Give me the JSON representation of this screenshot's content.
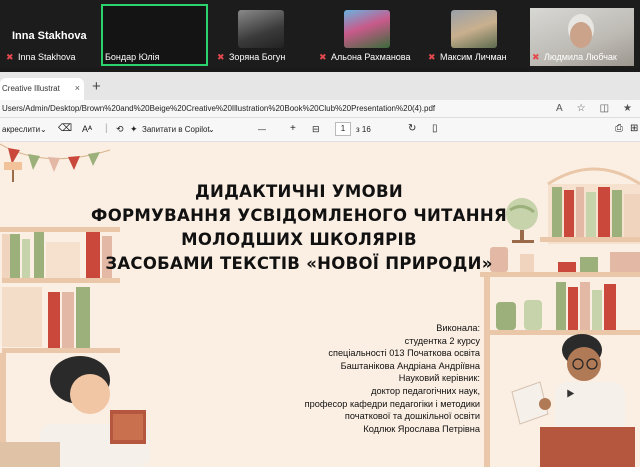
{
  "participants": [
    {
      "name": "Inna Stakhova",
      "tile_title": "Inna Stakhova",
      "muted": true
    },
    {
      "name": "Бондар Юлія",
      "muted": false,
      "active": true
    },
    {
      "name": "Зоряна Богун",
      "muted": true
    },
    {
      "name": "Альона Рахманова",
      "muted": true
    },
    {
      "name": "Максим Личман",
      "muted": true
    },
    {
      "name": "Людмила Любчак",
      "muted": true
    }
  ],
  "browser": {
    "tab_title": "Creative Illustrat",
    "tab_close": "×",
    "new_tab": "+",
    "url": "Users/Admin/Desktop/Brown%20and%20Beige%20Creative%20Illustration%20Book%20Club%20Presentation%20(4).pdf"
  },
  "pdf_toolbar": {
    "highlight_label": "акреслити",
    "copilot_label": "Запитати в Copilot",
    "page_current": "1",
    "page_total": "з 16"
  },
  "slide": {
    "title_lines": [
      "ДИДАКТИЧНІ УМОВИ",
      "ФОРМУВАННЯ УСВІДОМЛЕНОГО ЧИТАННЯ",
      "МОЛОДШИХ ШКОЛЯРІВ",
      "ЗАСОБАМИ ТЕКСТІВ «НОВОЇ ПРИРОДИ»"
    ],
    "info_lines": [
      "Виконала:",
      "студентка 2 курсу",
      "спеціальності 013 Початкова освіта",
      "Баштанікова Андріана Андріївна",
      "Науковий керівник:",
      "доктор педагогічних наук,",
      "професор кафедри педагогіки і методики",
      "початкової та дошкільної освіти",
      "Кодлюк Ярослава Петрівна"
    ]
  },
  "colors": {
    "active_speaker": "#2bd26e",
    "muted_mic": "#e5484d",
    "slide_bg": "#fbeee2",
    "book_green": "#9bb07a",
    "book_red": "#c9483b"
  }
}
